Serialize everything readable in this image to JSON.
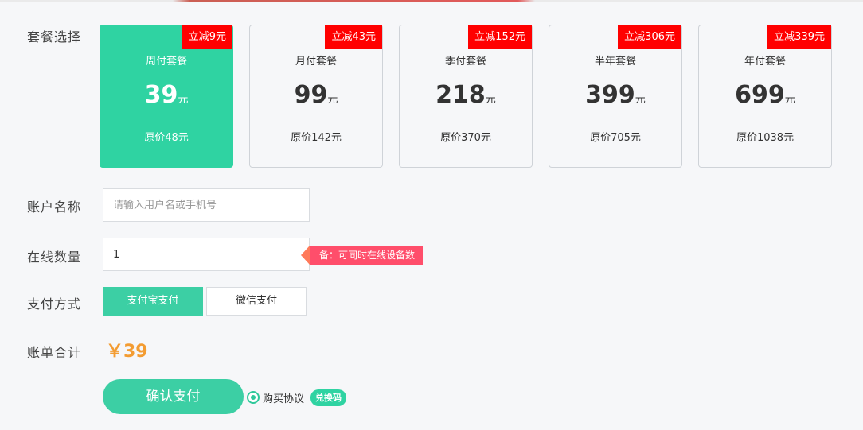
{
  "labels": {
    "plan": "套餐选择",
    "account": "账户名称",
    "online": "在线数量",
    "payment": "支付方式",
    "total": "账单合计"
  },
  "plans": [
    {
      "badge": "立减9元",
      "name": "周付套餐",
      "price": "39",
      "unit": "元",
      "original": "原价48元",
      "selected": true
    },
    {
      "badge": "立减43元",
      "name": "月付套餐",
      "price": "99",
      "unit": "元",
      "original": "原价142元",
      "selected": false
    },
    {
      "badge": "立减152元",
      "name": "季付套餐",
      "price": "218",
      "unit": "元",
      "original": "原价370元",
      "selected": false
    },
    {
      "badge": "立减306元",
      "name": "半年套餐",
      "price": "399",
      "unit": "元",
      "original": "原价705元",
      "selected": false
    },
    {
      "badge": "立减339元",
      "name": "年付套餐",
      "price": "699",
      "unit": "元",
      "original": "原价1038元",
      "selected": false
    }
  ],
  "account": {
    "value": "",
    "placeholder": "请输入用户名或手机号"
  },
  "online": {
    "value": "1",
    "hint": "备：可同时在线设备数"
  },
  "payment": {
    "methods": [
      "支付宝支付",
      "微信支付"
    ],
    "selected": "支付宝支付"
  },
  "total": {
    "amount": "￥39"
  },
  "actions": {
    "confirm": "确认支付",
    "agreement": "购买协议",
    "redeem": "兑换码"
  },
  "colors": {
    "accent": "#2fd3a2",
    "badge": "#ff0000",
    "price": "#f39c32",
    "hint": "#ff4e6b"
  }
}
